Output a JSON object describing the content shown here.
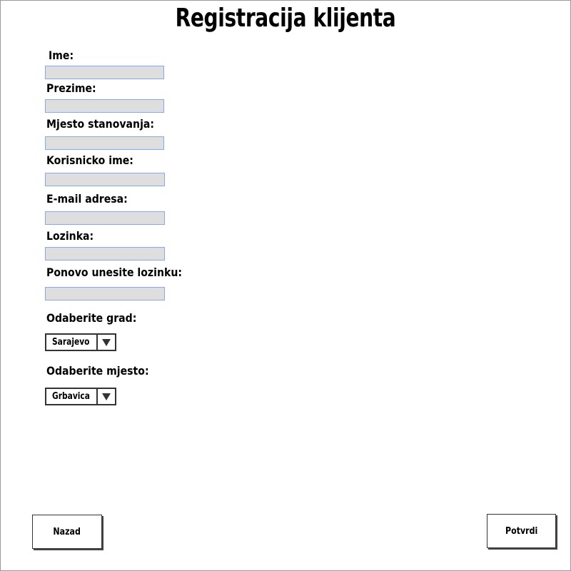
{
  "title": "Registracija klijenta",
  "fields": [
    {
      "label": "Ime:",
      "value": ""
    },
    {
      "label": "Prezime:",
      "value": ""
    },
    {
      "label": "Mjesto stanovanja:",
      "value": ""
    },
    {
      "label": "Korisnicko ime:",
      "value": ""
    },
    {
      "label": "E-mail adresa:",
      "value": ""
    },
    {
      "label": "Lozinka:",
      "value": ""
    },
    {
      "label": "Ponovo unesite lozinku:",
      "value": ""
    }
  ],
  "selects": [
    {
      "label": "Odaberite grad:",
      "value": "Sarajevo"
    },
    {
      "label": "Odaberite mjesto:",
      "value": "Grbavica"
    }
  ],
  "buttons": {
    "back_label": "Nazad",
    "confirm_label": "Potvrdi"
  },
  "colors": {
    "input_fill": "#dedede",
    "input_border": "#8aa6f0"
  }
}
